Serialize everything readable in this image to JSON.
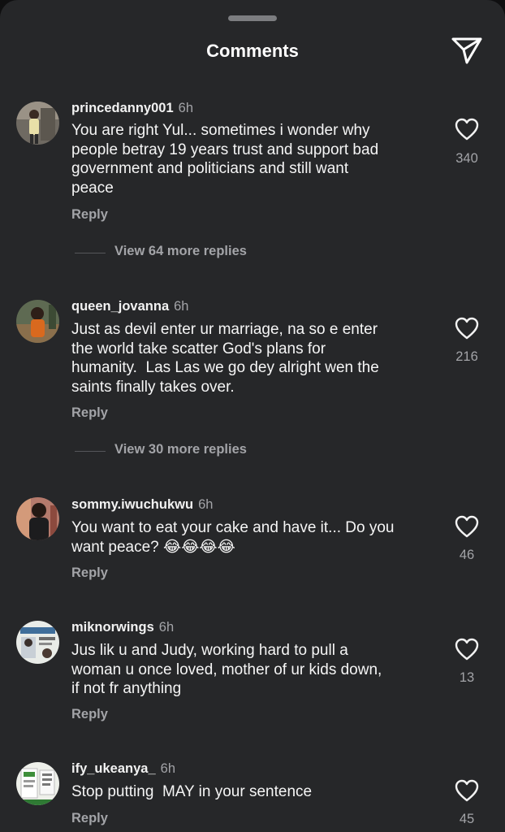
{
  "header": {
    "title": "Comments",
    "share_icon": "send-icon"
  },
  "colors": {
    "background": "#262729",
    "secondary_text": "#a3a4a8",
    "primary_text": "#f5f5f5"
  },
  "comments": [
    {
      "username": "princedanny001",
      "time": "6h",
      "text": "You are right Yul... sometimes i wonder why\npeople betray 19 years trust and support bad\ngovernment and politicians and still want\npeace",
      "reply_label": "Reply",
      "likes": "340",
      "view_replies": "View 64 more replies"
    },
    {
      "username": "queen_jovanna",
      "time": "6h",
      "text": "Just as devil enter ur marriage, na so e enter\nthe world take scatter God's plans for\nhumanity.  Las Las we go dey alright wen the\nsaints finally takes over.",
      "reply_label": "Reply",
      "likes": "216",
      "view_replies": "View 30 more replies"
    },
    {
      "username": "sommy.iwuchukwu",
      "time": "6h",
      "text": "You want to eat your cake and have it... Do you\nwant peace? 😂😂😂😂",
      "reply_label": "Reply",
      "likes": "46"
    },
    {
      "username": "miknorwings",
      "time": "6h",
      "text": "Jus lik u and Judy, working hard to pull a\nwoman u once loved, mother of ur kids down,\nif not fr anything",
      "reply_label": "Reply",
      "likes": "13"
    },
    {
      "username": "ify_ukeanya_",
      "time": "6h",
      "text": "Stop putting  MAY in your sentence",
      "reply_label": "Reply",
      "likes": "45"
    }
  ]
}
